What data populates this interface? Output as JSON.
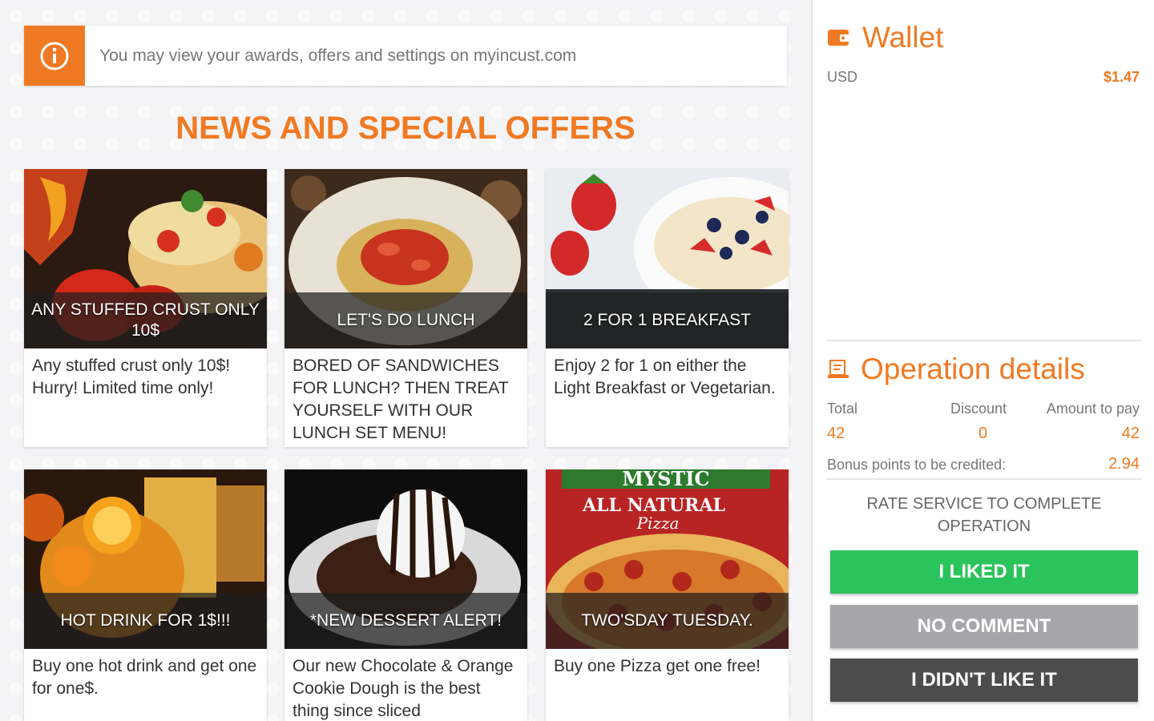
{
  "info_bar": {
    "icon": "info-icon",
    "text": "You may view your awards, offers and settings on myincust.com"
  },
  "section_title": "NEWS AND SPECIAL OFFERS",
  "offers": [
    {
      "caption": "ANY STUFFED CRUST ONLY 10$",
      "description": "Any stuffed crust only 10$! Hurry! Limited time only!"
    },
    {
      "caption": "LET'S DO LUNCH",
      "description": "BORED OF SANDWICHES FOR LUNCH? THEN TREAT YOURSELF WITH OUR LUNCH SET MENU!"
    },
    {
      "caption": "2 FOR 1 BREAKFAST",
      "description": "Enjoy 2 for 1 on either the Light  Breakfast or Vegetarian."
    },
    {
      "caption": "HOT DRINK FOR 1$!!!",
      "description": "Buy one hot drink and get one for one$."
    },
    {
      "caption": "*NEW DESSERT ALERT!",
      "description": "Our new Chocolate & Orange Cookie Dough is the best thing since sliced"
    },
    {
      "caption": "TWO'SDAY TUESDAY.",
      "description": "Buy one Pizza get one free!",
      "image_text": {
        "brand": "MYSTIC",
        "line1": "ALL NATURAL",
        "line2": "Pizza"
      }
    }
  ],
  "wallet": {
    "title": "Wallet",
    "icon": "wallet-icon",
    "currency": "USD",
    "balance": "$1.47"
  },
  "operation": {
    "title": "Operation details",
    "icon": "receipt-icon",
    "total_label": "Total",
    "total_value": "42",
    "discount_label": "Discount",
    "discount_value": "0",
    "amount_label": "Amount to pay",
    "amount_value": "42",
    "bonus_label": "Bonus points to be credited:",
    "bonus_value": "2.94"
  },
  "rate": {
    "prompt": "RATE SERVICE TO COMPLETE OPERATION",
    "liked": "I LIKED IT",
    "no_comment": "NO COMMENT",
    "disliked": "I DIDN'T LIKE IT"
  },
  "colors": {
    "accent": "#f07a23",
    "like": "#2bc35c",
    "neutral": "#a7a7ab",
    "dislike": "#4c4c4c"
  }
}
